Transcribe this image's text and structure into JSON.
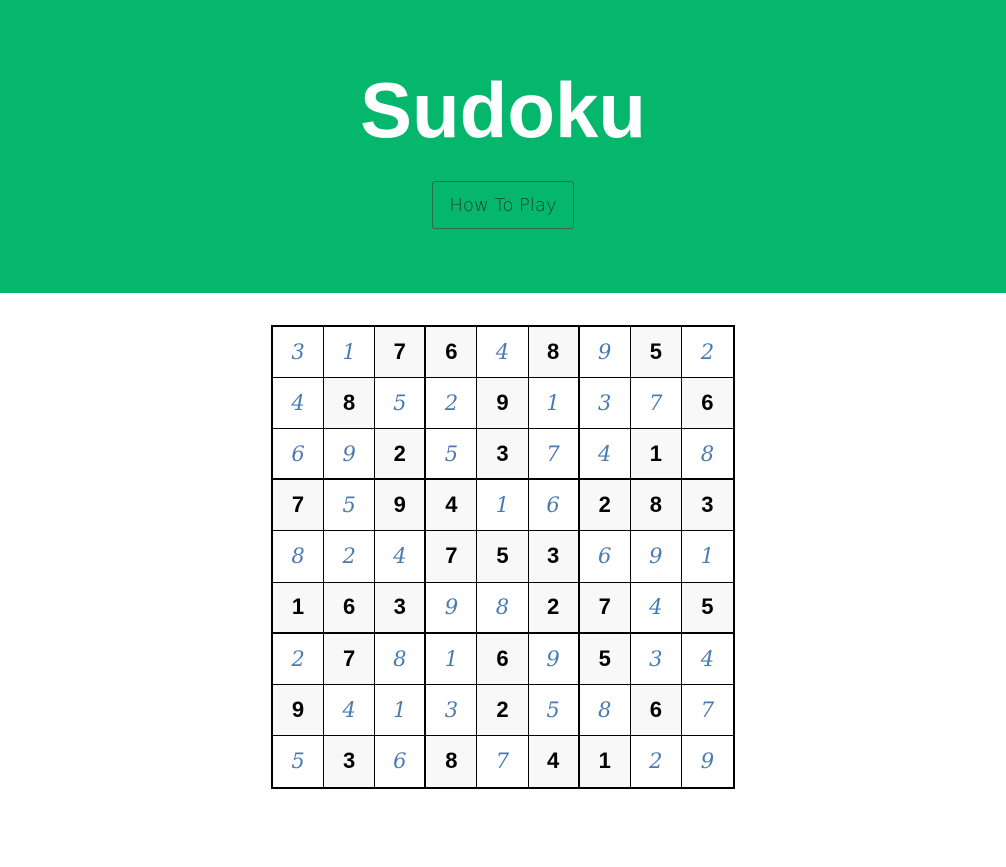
{
  "header": {
    "title": "Sudoku",
    "how_to_play_label": "How To Play",
    "background_color": "#05b76d"
  },
  "board": {
    "given_color": "#000000",
    "entry_color": "#4a7bb0",
    "rows": [
      [
        {
          "v": "3",
          "g": false
        },
        {
          "v": "1",
          "g": false
        },
        {
          "v": "7",
          "g": true
        },
        {
          "v": "6",
          "g": true
        },
        {
          "v": "4",
          "g": false
        },
        {
          "v": "8",
          "g": true
        },
        {
          "v": "9",
          "g": false
        },
        {
          "v": "5",
          "g": true
        },
        {
          "v": "2",
          "g": false
        }
      ],
      [
        {
          "v": "4",
          "g": false
        },
        {
          "v": "8",
          "g": true
        },
        {
          "v": "5",
          "g": false
        },
        {
          "v": "2",
          "g": false
        },
        {
          "v": "9",
          "g": true
        },
        {
          "v": "1",
          "g": false
        },
        {
          "v": "3",
          "g": false
        },
        {
          "v": "7",
          "g": false
        },
        {
          "v": "6",
          "g": true
        }
      ],
      [
        {
          "v": "6",
          "g": false
        },
        {
          "v": "9",
          "g": false
        },
        {
          "v": "2",
          "g": true
        },
        {
          "v": "5",
          "g": false
        },
        {
          "v": "3",
          "g": true
        },
        {
          "v": "7",
          "g": false
        },
        {
          "v": "4",
          "g": false
        },
        {
          "v": "1",
          "g": true
        },
        {
          "v": "8",
          "g": false
        }
      ],
      [
        {
          "v": "7",
          "g": true
        },
        {
          "v": "5",
          "g": false
        },
        {
          "v": "9",
          "g": true
        },
        {
          "v": "4",
          "g": true
        },
        {
          "v": "1",
          "g": false
        },
        {
          "v": "6",
          "g": false
        },
        {
          "v": "2",
          "g": true
        },
        {
          "v": "8",
          "g": true
        },
        {
          "v": "3",
          "g": true
        }
      ],
      [
        {
          "v": "8",
          "g": false
        },
        {
          "v": "2",
          "g": false
        },
        {
          "v": "4",
          "g": false
        },
        {
          "v": "7",
          "g": true
        },
        {
          "v": "5",
          "g": true
        },
        {
          "v": "3",
          "g": true
        },
        {
          "v": "6",
          "g": false
        },
        {
          "v": "9",
          "g": false
        },
        {
          "v": "1",
          "g": false
        }
      ],
      [
        {
          "v": "1",
          "g": true
        },
        {
          "v": "6",
          "g": true
        },
        {
          "v": "3",
          "g": true
        },
        {
          "v": "9",
          "g": false
        },
        {
          "v": "8",
          "g": false
        },
        {
          "v": "2",
          "g": true
        },
        {
          "v": "7",
          "g": true
        },
        {
          "v": "4",
          "g": false
        },
        {
          "v": "5",
          "g": true
        }
      ],
      [
        {
          "v": "2",
          "g": false
        },
        {
          "v": "7",
          "g": true
        },
        {
          "v": "8",
          "g": false
        },
        {
          "v": "1",
          "g": false
        },
        {
          "v": "6",
          "g": true
        },
        {
          "v": "9",
          "g": false
        },
        {
          "v": "5",
          "g": true
        },
        {
          "v": "3",
          "g": false
        },
        {
          "v": "4",
          "g": false
        }
      ],
      [
        {
          "v": "9",
          "g": true
        },
        {
          "v": "4",
          "g": false
        },
        {
          "v": "1",
          "g": false
        },
        {
          "v": "3",
          "g": false
        },
        {
          "v": "2",
          "g": true
        },
        {
          "v": "5",
          "g": false
        },
        {
          "v": "8",
          "g": false
        },
        {
          "v": "6",
          "g": true
        },
        {
          "v": "7",
          "g": false
        }
      ],
      [
        {
          "v": "5",
          "g": false
        },
        {
          "v": "3",
          "g": true
        },
        {
          "v": "6",
          "g": false
        },
        {
          "v": "8",
          "g": true
        },
        {
          "v": "7",
          "g": false
        },
        {
          "v": "4",
          "g": true
        },
        {
          "v": "1",
          "g": true
        },
        {
          "v": "2",
          "g": false
        },
        {
          "v": "9",
          "g": false
        }
      ]
    ]
  }
}
